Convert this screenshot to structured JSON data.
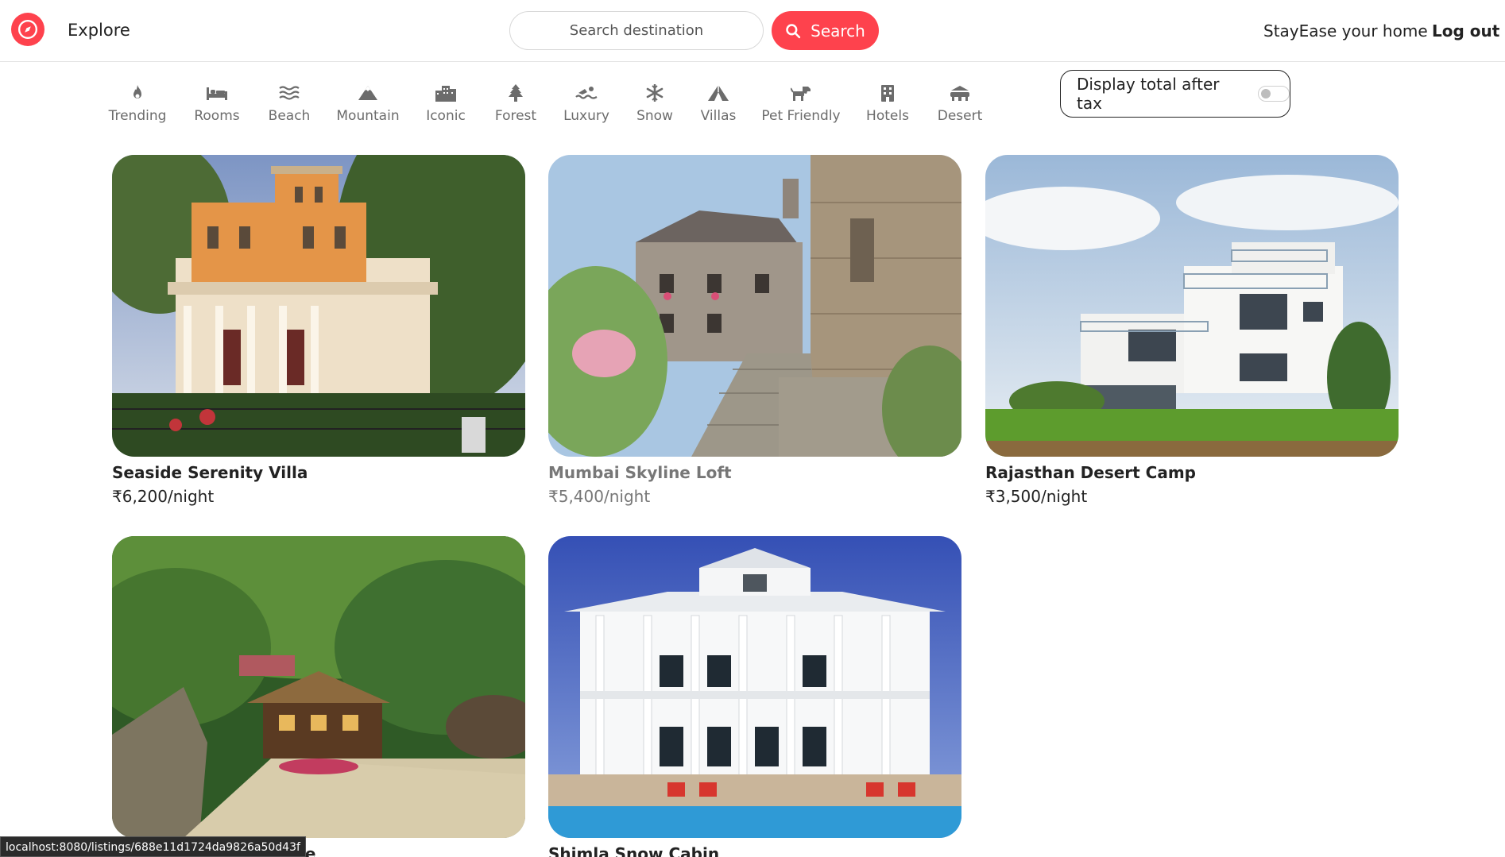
{
  "navbar": {
    "logo_icon": "compass-icon",
    "explore": "Explore",
    "search_placeholder": "Search destination",
    "search_button": "Search",
    "search_icon": "search-icon",
    "host": "StayEase your home",
    "logout": "Log out",
    "brand_color": "#fe424d"
  },
  "filters": [
    {
      "label": "Trending",
      "icon": "fire-icon"
    },
    {
      "label": "Rooms",
      "icon": "bed-icon"
    },
    {
      "label": "Beach",
      "icon": "water-icon"
    },
    {
      "label": "Mountain",
      "icon": "mountain-icon"
    },
    {
      "label": "Iconic",
      "icon": "city-icon"
    },
    {
      "label": "Forest",
      "icon": "tree-icon"
    },
    {
      "label": "Luxury",
      "icon": "swimmer-icon"
    },
    {
      "label": "Snow",
      "icon": "snowflake-icon"
    },
    {
      "label": "Villas",
      "icon": "tent-icon"
    },
    {
      "label": "Pet Friendly",
      "icon": "dog-icon"
    },
    {
      "label": "Hotels",
      "icon": "hotel-icon"
    },
    {
      "label": "Desert",
      "icon": "camel-icon"
    }
  ],
  "tax_toggle": {
    "label": "Display total after tax",
    "enabled": false
  },
  "listings": [
    {
      "title": "Seaside Serenity Villa",
      "price": "₹6,200/night",
      "image": "orange italian villa with trees"
    },
    {
      "title": "Mumbai Skyline Loft",
      "price": "₹5,400/night",
      "image": "stone cottage with cobblestone path"
    },
    {
      "title": "Rajasthan Desert Camp",
      "price": "₹3,500/night",
      "image": "modern white house on lawn"
    },
    {
      "title": "age",
      "price": "",
      "image": "thatched hut in green forest"
    },
    {
      "title": "Shimla Snow Cabin",
      "price": "",
      "image": "white colonial mansion with pool"
    }
  ],
  "status_bar": "localhost:8080/listings/688e11d1724da9826a50d43f"
}
